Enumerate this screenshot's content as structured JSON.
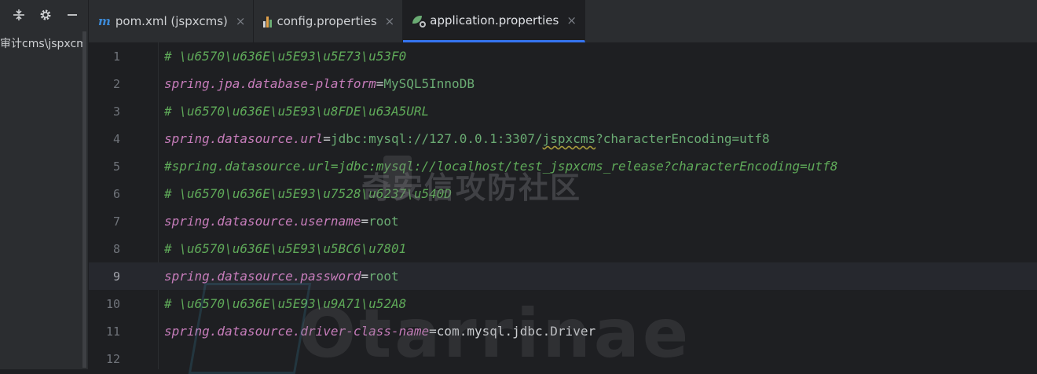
{
  "left_panel": {
    "toolbar_icons": [
      "collapse-icon",
      "gear-icon",
      "minimize-icon"
    ],
    "tree_item": "审计cms\\jspxcm"
  },
  "tabs": [
    {
      "icon": "maven-icon",
      "label": "pom.xml (jspxcms)",
      "active": false
    },
    {
      "icon": "properties-chart-icon",
      "label": "config.properties",
      "active": false
    },
    {
      "icon": "spring-boot-icon",
      "label": "application.properties",
      "active": true
    }
  ],
  "tab_close_glyph": "×",
  "editor": {
    "current_line": 9,
    "lines": [
      {
        "n": "1",
        "type": "comment",
        "text": "# \\u6570\\u636E\\u5E93\\u5E73\\u53F0"
      },
      {
        "n": "2",
        "type": "prop",
        "key": "spring.jpa.database-platform",
        "value": "MySQL5InnoDB"
      },
      {
        "n": "3",
        "type": "comment",
        "text": "# \\u6570\\u636E\\u5E93\\u8FDE\\u63A5URL"
      },
      {
        "n": "4",
        "type": "prop_url",
        "key": "spring.datasource.url",
        "value_pre": "jdbc:mysql://127.0.0.1:3307/",
        "value_squig": "jspxcms",
        "value_post": "?characterEncoding=utf8"
      },
      {
        "n": "5",
        "type": "comment",
        "text": "#spring.datasource.url=jdbc:mysql://localhost/test_jspxcms_release?characterEncoding=utf8"
      },
      {
        "n": "6",
        "type": "comment",
        "text": "# \\u6570\\u636E\\u5E93\\u7528\\u6237\\u540D"
      },
      {
        "n": "7",
        "type": "prop",
        "key": "spring.datasource.username",
        "value": "root"
      },
      {
        "n": "8",
        "type": "comment",
        "text": "# \\u6570\\u636E\\u5E93\\u5BC6\\u7801"
      },
      {
        "n": "9",
        "type": "prop",
        "key": "spring.datasource.password",
        "value": "root"
      },
      {
        "n": "10",
        "type": "comment",
        "text": "# \\u6570\\u636E\\u5E93\\u9A71\\u52A8"
      },
      {
        "n": "11",
        "type": "prop_plain",
        "key": "spring.datasource.driver-class-name",
        "value": "com.mysql.jdbc.Driver"
      },
      {
        "n": "12",
        "type": "empty"
      }
    ]
  },
  "watermark": {
    "cn": "奇安信攻防社区",
    "en": "Otarrinae"
  },
  "colors": {
    "background": "#1e1f22",
    "panel": "#2b2d30",
    "accent": "#3574f0",
    "comment": "#5faa59",
    "key": "#c77dbb",
    "value": "#6aab73"
  }
}
